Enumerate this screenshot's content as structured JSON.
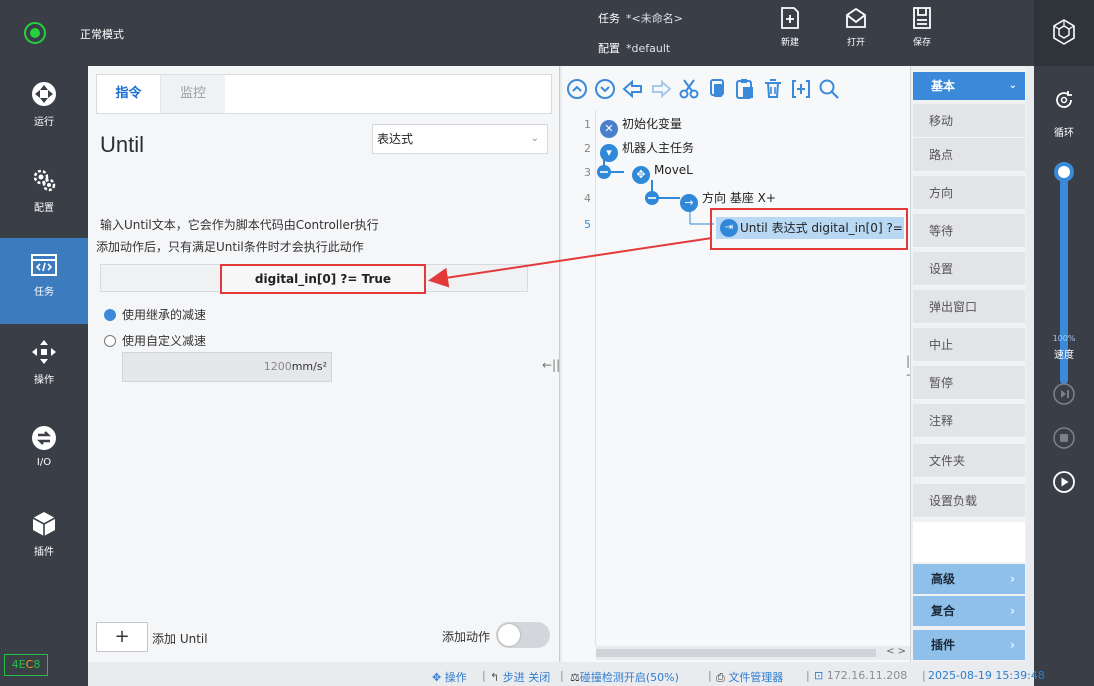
{
  "header": {
    "mode": "正常模式",
    "task_label": "任务",
    "task_value": "*<未命名>",
    "config_label": "配置",
    "config_value": "*default",
    "buttons": {
      "new": "新建",
      "open": "打开",
      "save": "保存"
    }
  },
  "nav": {
    "items": [
      {
        "label": "运行",
        "icon": "run-icon"
      },
      {
        "label": "配置",
        "icon": "config-gears-icon"
      },
      {
        "label": "任务",
        "icon": "task-code-icon"
      },
      {
        "label": "操作",
        "icon": "move-arrows-icon"
      },
      {
        "label": "I/O",
        "icon": "io-icon"
      },
      {
        "label": "插件",
        "icon": "plugin-cube-icon"
      }
    ],
    "model_a": "4E",
    "model_b": "C",
    "model_c": "8"
  },
  "instruction": {
    "tab_command": "指令",
    "tab_monitor": "监控",
    "title": "Until",
    "type_select": "表达式",
    "desc_line1": "输入Until文本，它会作为脚本代码由Controller执行",
    "desc_line2": "添加动作后，只有满足Until条件时才会执行此动作",
    "expression": "digital_in[0] ?=  True",
    "radio_inherit": "使用继承的减速",
    "radio_custom": "使用自定义减速",
    "decel_value": "1200",
    "decel_unit": "mm/s²",
    "add_until_plus": "+",
    "add_until_label": "添加 Until",
    "add_action_label": "添加动作"
  },
  "tree": {
    "lines": [
      "1",
      "2",
      "3",
      "4",
      "5"
    ],
    "nodes": {
      "init": "初始化变量",
      "main": "机器人主任务",
      "movel": "MoveL",
      "direction": "方向 基座 X+",
      "until": "Until 表达式 digital_in[0] ?="
    }
  },
  "categories": {
    "head": "基本",
    "items": [
      "移动",
      "路点",
      "方向",
      "等待",
      "设置",
      "弹出窗口",
      "中止",
      "暂停",
      "注释",
      "文件夹",
      "设置负载"
    ],
    "groups": [
      "高级",
      "复合",
      "插件"
    ]
  },
  "rail": {
    "loop": "循环",
    "speed_pct": "100%",
    "speed_label": "速度",
    "speed_fraction": 1.0
  },
  "status": {
    "op": "操作",
    "step": "步进 关闭",
    "collision": "碰撞检测开启(50%)",
    "files": "文件管理器",
    "ip": "172.16.11.208",
    "datetime": "2025-08-19 15:39:48"
  },
  "colors": {
    "accent": "#3b8ad9",
    "annotation_red": "#e23a3a",
    "ok_green": "#25d13d"
  }
}
